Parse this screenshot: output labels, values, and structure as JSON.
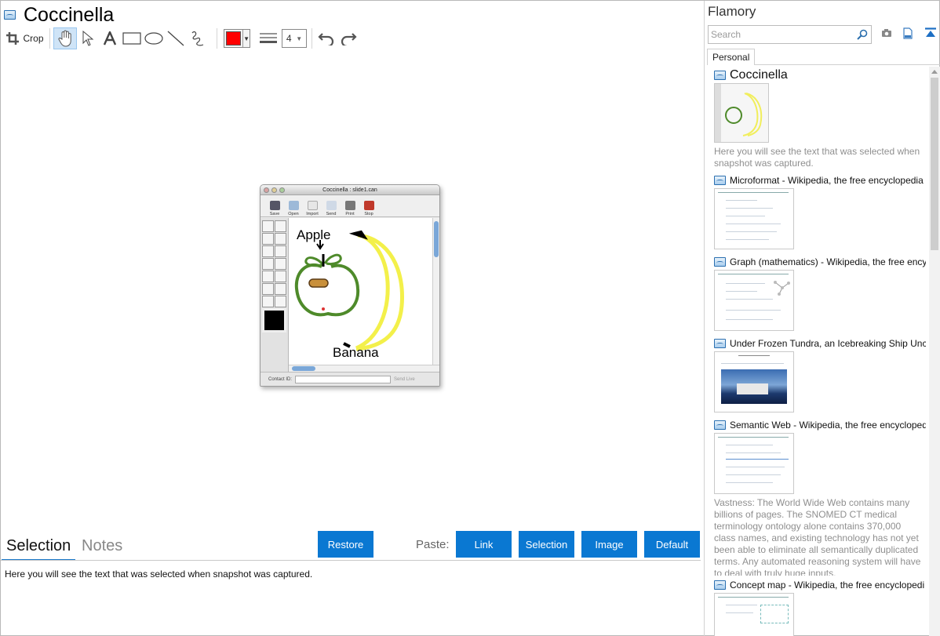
{
  "app": {
    "title": "Coccinella"
  },
  "toolbar": {
    "crop_label": "Crop",
    "tools": [
      {
        "name": "hand-tool",
        "icon": "hand-icon",
        "active": true
      },
      {
        "name": "pointer-tool",
        "icon": "arrow-pointer-icon"
      },
      {
        "name": "text-tool",
        "icon": "text-a-icon"
      },
      {
        "name": "rectangle-tool",
        "icon": "rectangle-icon"
      },
      {
        "name": "ellipse-tool",
        "icon": "ellipse-icon"
      },
      {
        "name": "line-tool",
        "icon": "line-icon"
      },
      {
        "name": "freehand-tool",
        "icon": "squiggle-icon"
      }
    ],
    "color_value": "#ff0000",
    "line_width_value": "4",
    "undo_icon": "undo-icon",
    "redo_icon": "redo-icon"
  },
  "snapshot": {
    "window_title": "Coccinella : slide1.can",
    "tools": [
      "Save",
      "Open",
      "Import",
      "Send",
      "Print",
      "Stop"
    ],
    "labels": {
      "apple": "Apple",
      "banana": "Banana"
    },
    "footer": {
      "contact_label": "Contact ID:",
      "send_live_label": "Send Live"
    }
  },
  "bottom": {
    "tabs": {
      "selection": "Selection",
      "notes": "Notes"
    },
    "restore_label": "Restore",
    "paste_label": "Paste:",
    "paste_buttons": {
      "link": "Link",
      "selection": "Selection",
      "image": "Image",
      "default": "Default"
    },
    "selection_text": "Here you will see the text that was selected when snapshot was captured."
  },
  "panel": {
    "title": "Flamory",
    "search_placeholder": "Search",
    "tab_personal": "Personal",
    "entries": [
      {
        "title": "Coccinella",
        "desc": "Here you will see the text that was selected when snapshot was captured."
      },
      {
        "title": "Microformat - Wikipedia, the free encyclopedia",
        "desc": ""
      },
      {
        "title": "Graph (mathematics) - Wikipedia, the free ency",
        "desc": ""
      },
      {
        "title": "Under Frozen Tundra, an Icebreaking Ship Unco",
        "desc": ""
      },
      {
        "title": "Semantic Web - Wikipedia, the free encycloped",
        "desc": "Vastness: The World Wide Web contains many billions of pages. The SNOMED CT medical terminology ontology alone contains 370,000 class names, and existing technology has not yet been able to eliminate all semantically duplicated terms. Any automated reasoning system will have to deal with truly huge inputs."
      },
      {
        "title": "Concept map - Wikipedia, the free encyclopedi",
        "desc": ""
      }
    ]
  },
  "colors": {
    "accent": "#0a78d2",
    "active_tool": "#cfe4f7"
  }
}
